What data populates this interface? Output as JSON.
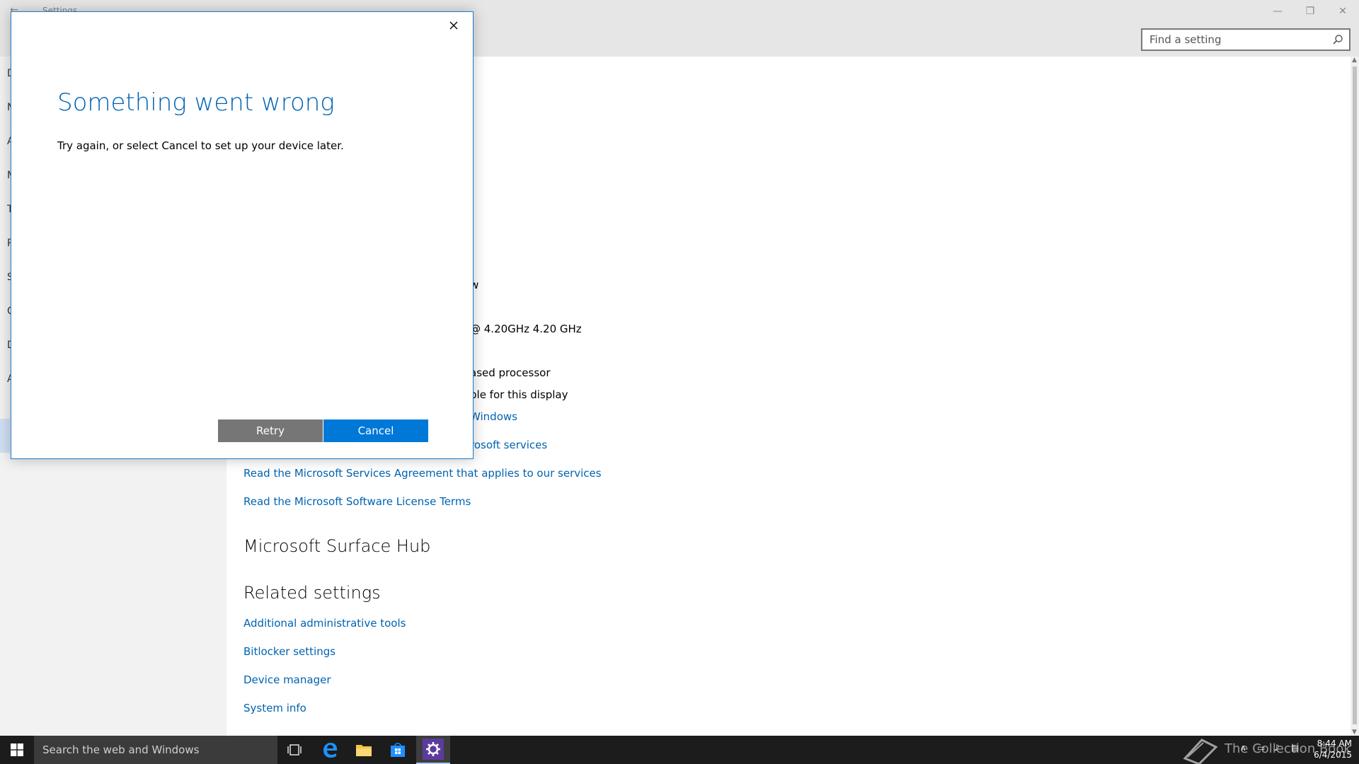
{
  "window": {
    "title": "Settings",
    "controls": {
      "minimize": "—",
      "maximize": "❐",
      "close": "✕"
    },
    "search_placeholder": "Find a setting"
  },
  "leftpane": {
    "items": [
      "D",
      "N",
      "A",
      "M",
      "T",
      "P",
      "S",
      "C",
      "D",
      "A"
    ]
  },
  "content": {
    "lines": [
      "w",
      "@ 4.20GHz   4.20 GHz",
      "ased processor",
      "ble for this display"
    ],
    "partial_links": [
      "Windows",
      "rosoft services"
    ],
    "links": [
      "Read the Microsoft Services Agreement that applies to our services",
      "Read the Microsoft Software License Terms"
    ],
    "heading_surface": "Microsoft Surface Hub",
    "heading_related": "Related settings",
    "related_links": [
      "Additional administrative tools",
      "Bitlocker settings",
      "Device manager",
      "System info"
    ]
  },
  "dialog": {
    "title": "Something went wrong",
    "message": "Try again, or select Cancel to set up your device later.",
    "retry_label": "Retry",
    "cancel_label": "Cancel"
  },
  "taskbar": {
    "search_text": "Search the web and Windows",
    "watermark": "The Collection Book",
    "time": "8:44 AM",
    "date": "6/4/2015"
  },
  "colors": {
    "accent": "#0078d7",
    "link": "#0063b1",
    "retry_bg": "#767676",
    "taskbar": "#1c1c1c"
  }
}
